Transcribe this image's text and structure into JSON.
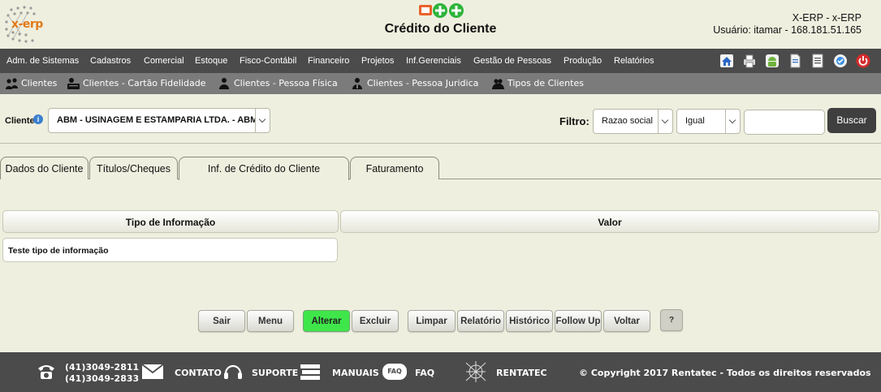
{
  "header": {
    "logo_text": "x-erp",
    "title": "Crédito do Cliente",
    "system_name": "X-ERP - x-ERP",
    "user_info": "Usuário: itamar - 168.181.51.165"
  },
  "main_menu": [
    "Adm. de Sistemas",
    "Cadastros",
    "Comercial",
    "Estoque",
    "Fisco-Contábil",
    "Financeiro",
    "Projetos",
    "Inf.Gerenciais",
    "Gestão de Pessoas",
    "Produção",
    "Relatórios"
  ],
  "sub_menu": [
    "Clientes",
    "Clientes - Cartão Fidelidade",
    "Clientes - Pessoa Física",
    "Clientes - Pessoa Juridica",
    "Tipos de Clientes"
  ],
  "client": {
    "label": "Cliente",
    "selected": "ABM - USINAGEM E ESTAMPARIA LTDA. - ABM - C"
  },
  "filter": {
    "label": "Filtro:",
    "field": "Razao social",
    "operator": "Igual",
    "value": "",
    "search_label": "Buscar"
  },
  "tabs": [
    "Dados do Cliente",
    "Títulos/Cheques",
    "Inf. de Crédito do Cliente",
    "Faturamento"
  ],
  "active_tab": 2,
  "grid": {
    "columns": [
      "Tipo de Informação",
      "Valor"
    ],
    "rows": [
      [
        "Teste tipo de informação",
        ""
      ]
    ]
  },
  "buttons": {
    "exit": "Sair",
    "menu": "Menu",
    "edit": "Alterar",
    "delete": "Excluir",
    "clear": "Limpar",
    "report": "Relatório",
    "history": "Histórico",
    "follow_up": "Follow Up",
    "back": "Voltar",
    "help": "?"
  },
  "footer": {
    "phone_1": "(41)3049-2811",
    "phone_2": "(41)3049-2833",
    "contact": "CONTATO",
    "support": "SUPORTE",
    "manuals": "MANUAIS",
    "faq_badge": "FAQ",
    "faq": "FAQ",
    "company": "RENTATEC",
    "copyright": "© Copyright 2017 Rentatec - Todos os direitos reservados"
  },
  "colors": {
    "page_bg": "#efefdf",
    "menu_bg": "#4b4b4b",
    "submenu_bg": "#7b7b7b",
    "edit_button": "#3fe64a",
    "logo_accent": "#e07a18"
  },
  "icons": {
    "toolbar": [
      "home-icon",
      "print-icon",
      "android-icon",
      "document-icon",
      "notes-icon",
      "chat-icon",
      "power-icon"
    ]
  }
}
